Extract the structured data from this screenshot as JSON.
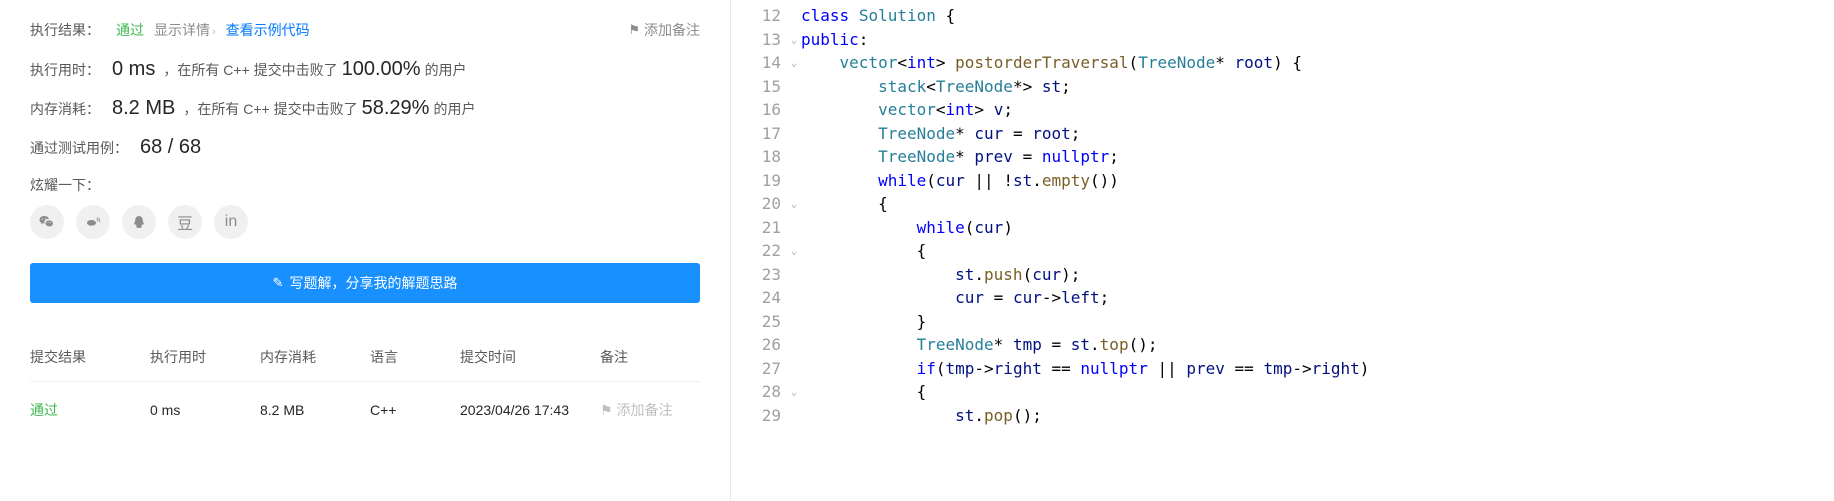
{
  "result": {
    "label": "执行结果：",
    "status": "通过",
    "detail_link": "显示详情",
    "example_link": "查看示例代码",
    "add_note": "添加备注"
  },
  "stats": {
    "time_label": "执行用时：",
    "time_value": "0 ms",
    "time_prefix": "，在所有 C++ 提交中击败了",
    "time_percent": "100.00%",
    "time_suffix": "的用户",
    "mem_label": "内存消耗：",
    "mem_value": "8.2 MB",
    "mem_prefix": "，在所有 C++ 提交中击败了",
    "mem_percent": "58.29%",
    "mem_suffix": "的用户",
    "cases_label": "通过测试用例：",
    "cases_value": "68 / 68"
  },
  "share": {
    "label": "炫耀一下："
  },
  "share_button": "写题解，分享我的解题思路",
  "table": {
    "headers": {
      "result": "提交结果",
      "time": "执行用时",
      "mem": "内存消耗",
      "lang": "语言",
      "date": "提交时间",
      "note": "备注"
    },
    "row": {
      "result": "通过",
      "time": "0 ms",
      "mem": "8.2 MB",
      "lang": "C++",
      "date": "2023/04/26 17:43",
      "note": "添加备注"
    }
  },
  "code": {
    "lines": [
      "12",
      "13",
      "14",
      "15",
      "16",
      "17",
      "18",
      "19",
      "20",
      "21",
      "22",
      "23",
      "24",
      "25",
      "26",
      "27",
      "28",
      "29"
    ],
    "folds": {
      "13": "⌄",
      "14": "⌄",
      "20": "⌄",
      "22": "⌄",
      "28": "⌄"
    }
  }
}
